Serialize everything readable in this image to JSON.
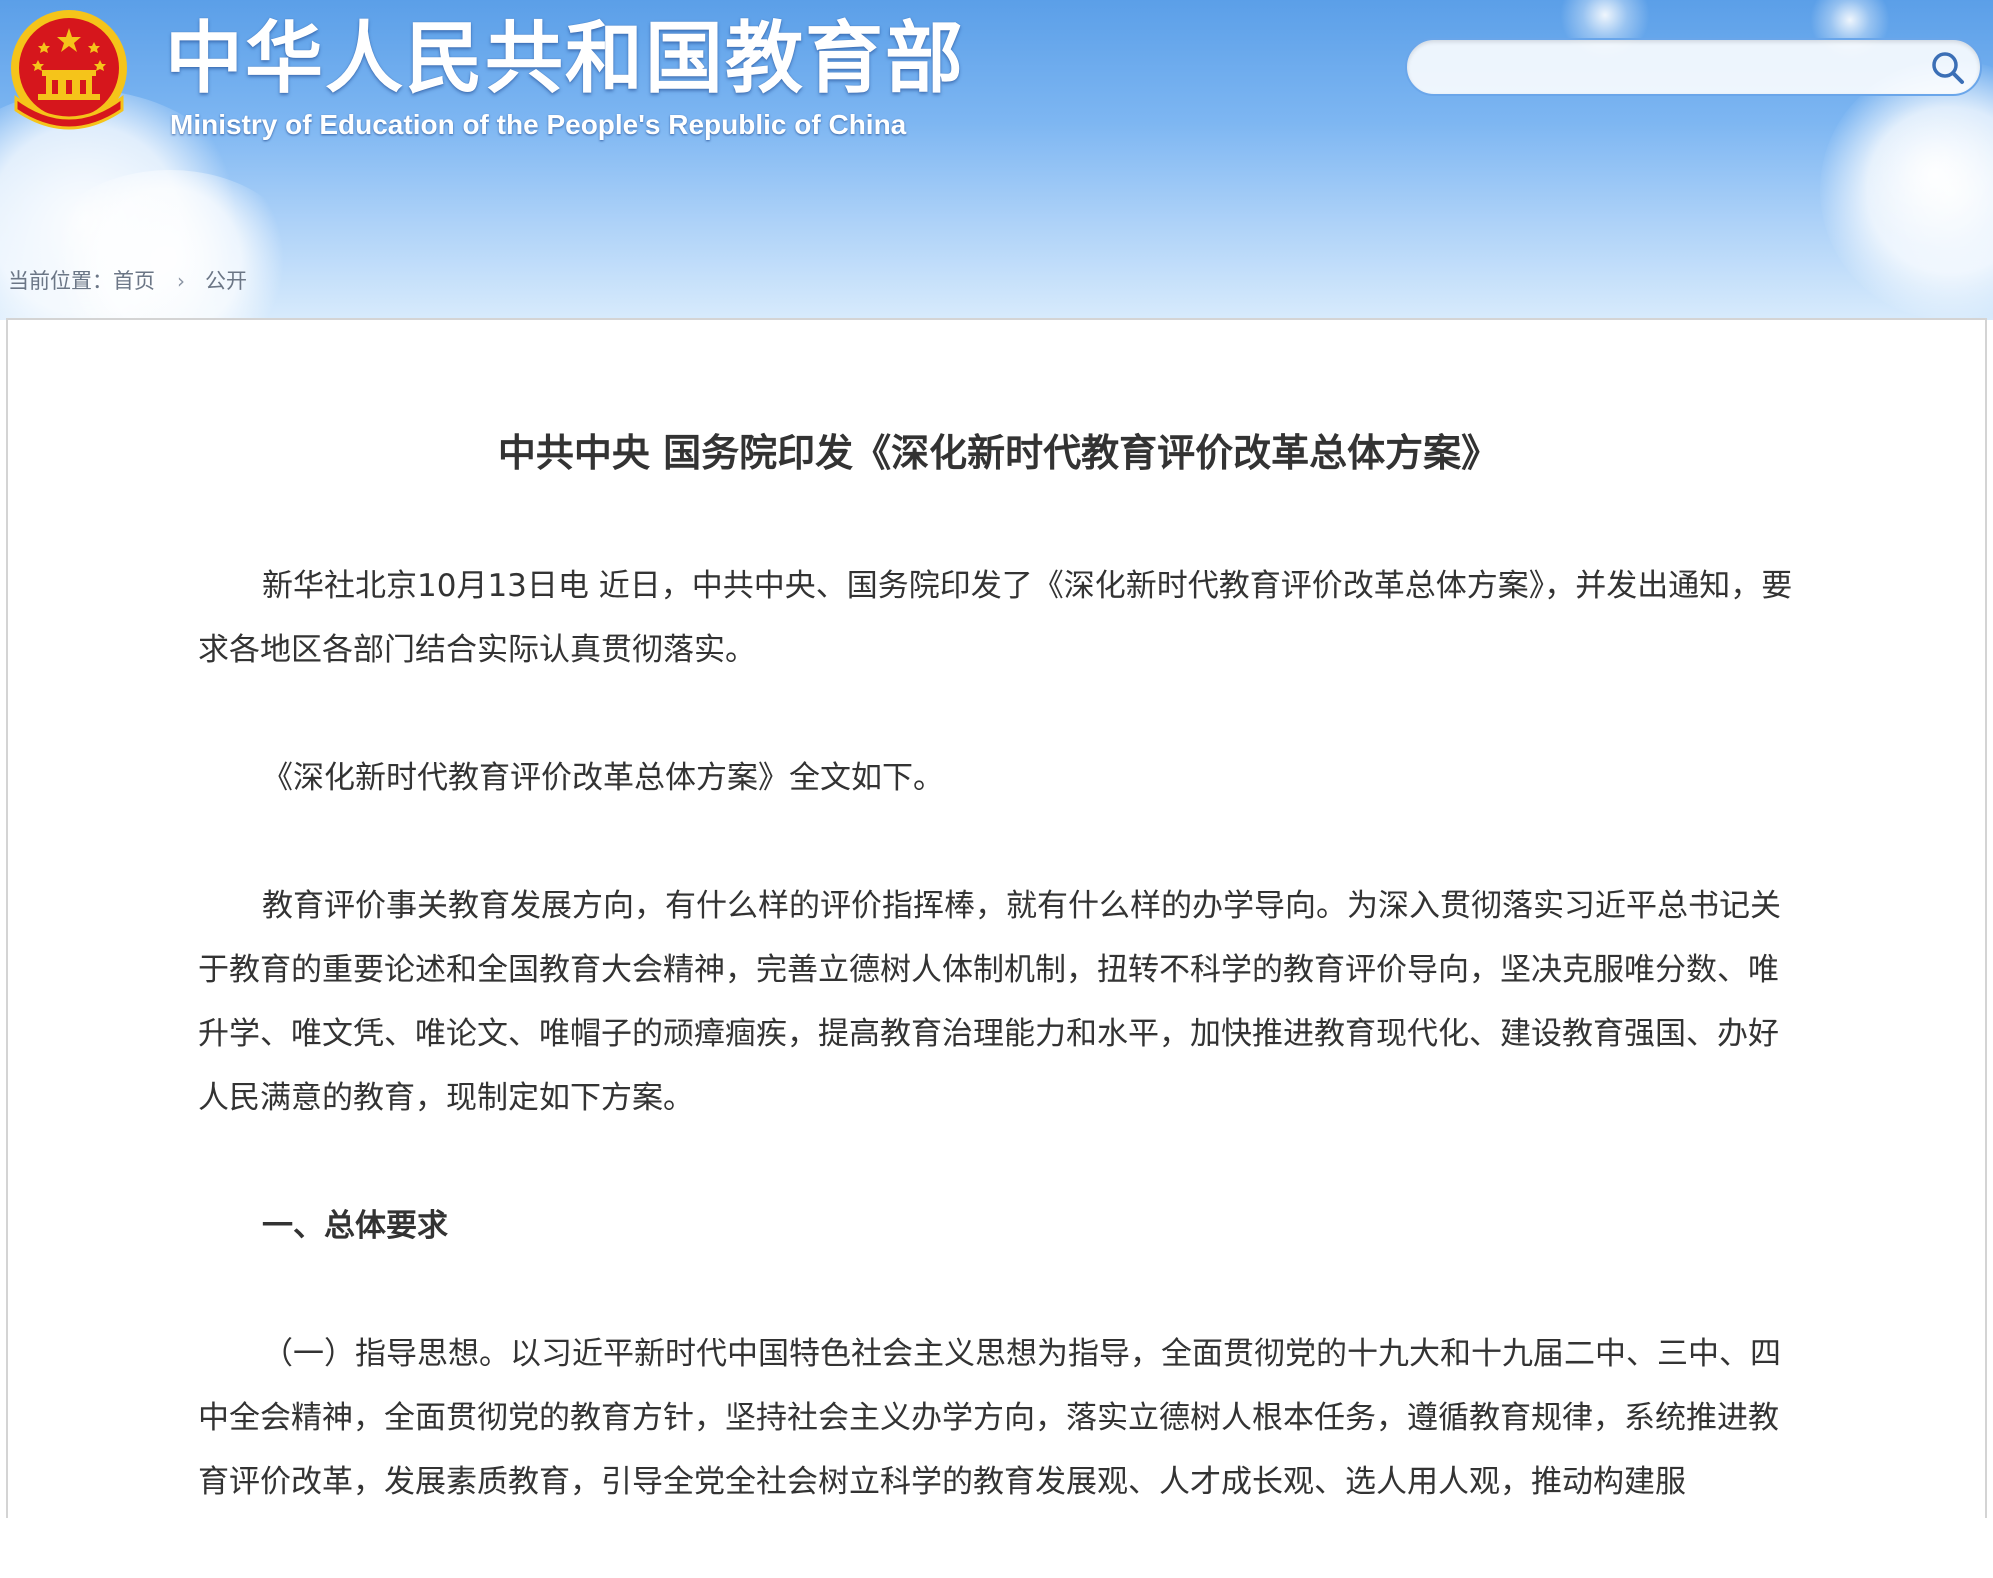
{
  "header": {
    "site_title": "中华人民共和国教育部",
    "site_subtitle": "Ministry of Education of the People's Republic of China",
    "emblem_icon": "national-emblem-icon",
    "search": {
      "value": "",
      "placeholder": "",
      "button_icon": "search-icon"
    },
    "colors": {
      "sky_top": "#5b9fe8",
      "sky_bottom": "#d8ebfc",
      "emblem_red": "#d6161c",
      "emblem_gold": "#f5c41a"
    }
  },
  "breadcrumb": {
    "label": "当前位置：",
    "items": [
      "首页",
      "公开"
    ],
    "separator_icon": "chevron-right-icon"
  },
  "article": {
    "title": "中共中央 国务院印发《深化新时代教育评价改革总体方案》",
    "paragraphs": [
      "新华社北京10月13日电 近日，中共中央、国务院印发了《深化新时代教育评价改革总体方案》，并发出通知，要求各地区各部门结合实际认真贯彻落实。",
      "《深化新时代教育评价改革总体方案》全文如下。",
      "教育评价事关教育发展方向，有什么样的评价指挥棒，就有什么样的办学导向。为深入贯彻落实习近平总书记关于教育的重要论述和全国教育大会精神，完善立德树人体制机制，扭转不科学的教育评价导向，坚决克服唯分数、唯升学、唯文凭、唯论文、唯帽子的顽瘴痼疾，提高教育治理能力和水平，加快推进教育现代化、建设教育强国、办好人民满意的教育，现制定如下方案。",
      "一、总体要求",
      "（一）指导思想。以习近平新时代中国特色社会主义思想为指导，全面贯彻党的十九大和十九届二中、三中、四中全会精神，全面贯彻党的教育方针，坚持社会主义办学方向，落实立德树人根本任务，遵循教育规律，系统推进教育评价改革，发展素质教育，引导全党全社会树立科学的教育发展观、人才成长观、选人用人观，推动构建服"
    ]
  }
}
